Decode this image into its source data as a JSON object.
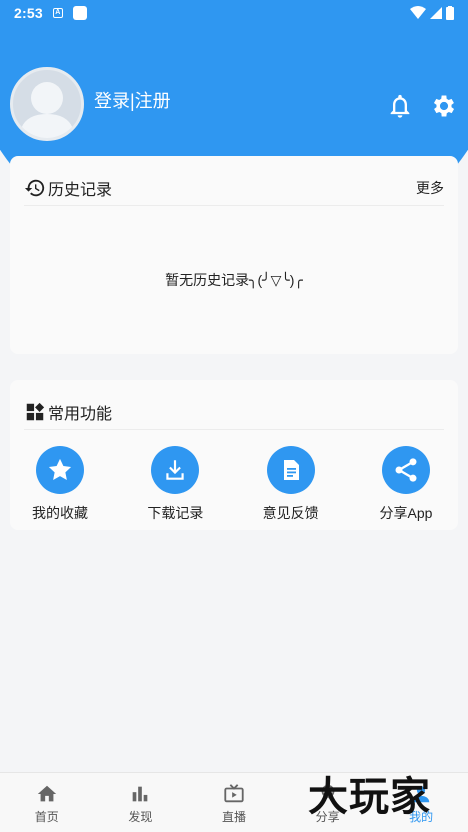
{
  "status_bar": {
    "time": "2:53",
    "app_badge": "A"
  },
  "header": {
    "login_text": "登录|注册",
    "bell_icon": "bell-icon",
    "settings_icon": "gear-icon"
  },
  "history": {
    "title": "历史记录",
    "more": "更多",
    "empty": "暂无历史记录╮(╯▽╰)╭"
  },
  "functions": {
    "title": "常用功能",
    "items": [
      {
        "label": "我的收藏",
        "icon": "star-icon"
      },
      {
        "label": "下载记录",
        "icon": "download-icon"
      },
      {
        "label": "意见反馈",
        "icon": "document-icon"
      },
      {
        "label": "分享App",
        "icon": "share-icon"
      }
    ]
  },
  "bottom_nav": {
    "items": [
      {
        "label": "首页",
        "icon": "home-icon"
      },
      {
        "label": "发现",
        "icon": "bar-chart-icon"
      },
      {
        "label": "直播",
        "icon": "tv-icon"
      },
      {
        "label": "分享",
        "icon": "share-nav-icon"
      },
      {
        "label": "我的",
        "icon": "person-icon",
        "active": true
      }
    ]
  },
  "watermark": "大玩家",
  "colors": {
    "accent": "#2f97f1",
    "background": "#f4f5f7",
    "card": "#fafafa"
  }
}
